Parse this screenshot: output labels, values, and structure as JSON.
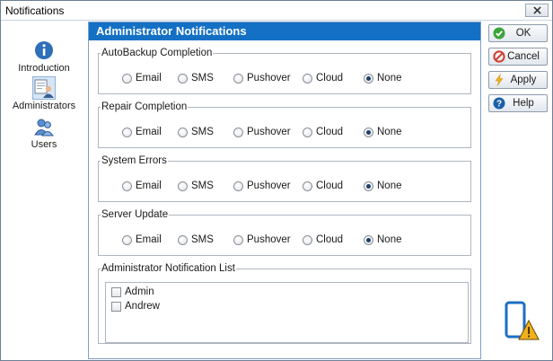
{
  "window": {
    "title": "Notifications"
  },
  "sidebar": {
    "items": [
      {
        "label": "Introduction",
        "icon": "info-icon",
        "selected": false
      },
      {
        "label": "Administrators",
        "icon": "administrators-icon",
        "selected": true
      },
      {
        "label": "Users",
        "icon": "users-icon",
        "selected": false
      }
    ]
  },
  "panel": {
    "title": "Administrator Notifications",
    "options": [
      "Email",
      "SMS",
      "Pushover",
      "Cloud",
      "None"
    ],
    "groups": [
      {
        "legend": "AutoBackup Completion",
        "selected": "None"
      },
      {
        "legend": "Repair Completion",
        "selected": "None"
      },
      {
        "legend": "System Errors",
        "selected": "None"
      },
      {
        "legend": "Server Update",
        "selected": "None"
      }
    ],
    "list": {
      "legend": "Administrator Notification List",
      "items": [
        {
          "label": "Admin",
          "checked": false
        },
        {
          "label": "Andrew",
          "checked": false
        }
      ]
    }
  },
  "buttons": {
    "ok": "OK",
    "cancel": "Cancel",
    "apply": "Apply",
    "help": "Help"
  },
  "colors": {
    "header": "#1470c5",
    "ok_icon": "#3aa43a",
    "cancel_icon": "#d23a2c",
    "apply_icon": "#f2b01e",
    "help_icon": "#1b5fa8"
  }
}
